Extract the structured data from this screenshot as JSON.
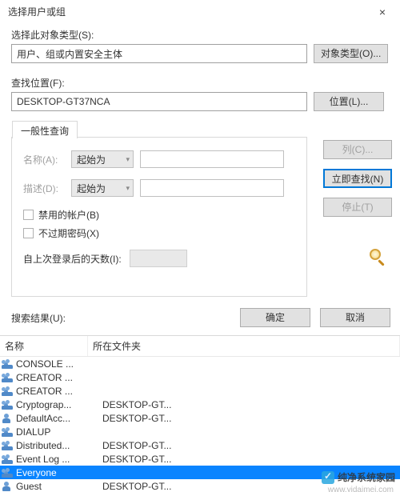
{
  "window": {
    "title": "选择用户或组",
    "close": "×"
  },
  "objType": {
    "label": "选择此对象类型(S):",
    "value": "用户、组或内置安全主体",
    "button": "对象类型(O)..."
  },
  "location": {
    "label": "查找位置(F):",
    "value": "DESKTOP-GT37NCA",
    "button": "位置(L)..."
  },
  "tab": {
    "label": "一般性查询",
    "nameLabel": "名称(A):",
    "descLabel": "描述(D):",
    "comboValue": "起始为",
    "disabledAccounts": "禁用的帐户(B)",
    "nonExpiringPw": "不过期密码(X)",
    "daysSinceLogon": "自上次登录后的天数(I):"
  },
  "sideButtons": {
    "columns": "列(C)...",
    "findNow": "立即查找(N)",
    "stop": "停止(T)"
  },
  "dialogButtons": {
    "ok": "确定",
    "cancel": "取消"
  },
  "results": {
    "label": "搜索结果(U):",
    "colName": "名称",
    "colFolder": "所在文件夹",
    "rows": [
      {
        "icon": "group",
        "name": "CONSOLE ...",
        "folder": "",
        "selected": false
      },
      {
        "icon": "group",
        "name": "CREATOR ...",
        "folder": "",
        "selected": false
      },
      {
        "icon": "group",
        "name": "CREATOR ...",
        "folder": "",
        "selected": false
      },
      {
        "icon": "group",
        "name": "Cryptograp...",
        "folder": "DESKTOP-GT...",
        "selected": false
      },
      {
        "icon": "user",
        "name": "DefaultAcc...",
        "folder": "DESKTOP-GT...",
        "selected": false
      },
      {
        "icon": "group",
        "name": "DIALUP",
        "folder": "",
        "selected": false
      },
      {
        "icon": "group",
        "name": "Distributed...",
        "folder": "DESKTOP-GT...",
        "selected": false
      },
      {
        "icon": "group",
        "name": "Event Log ...",
        "folder": "DESKTOP-GT...",
        "selected": false
      },
      {
        "icon": "group",
        "name": "Everyone",
        "folder": "",
        "selected": true
      },
      {
        "icon": "user",
        "name": "Guest",
        "folder": "DESKTOP-GT...",
        "selected": false
      }
    ]
  },
  "watermark": {
    "text": "纯净系统家园",
    "url": "www.yidaimei.com"
  }
}
